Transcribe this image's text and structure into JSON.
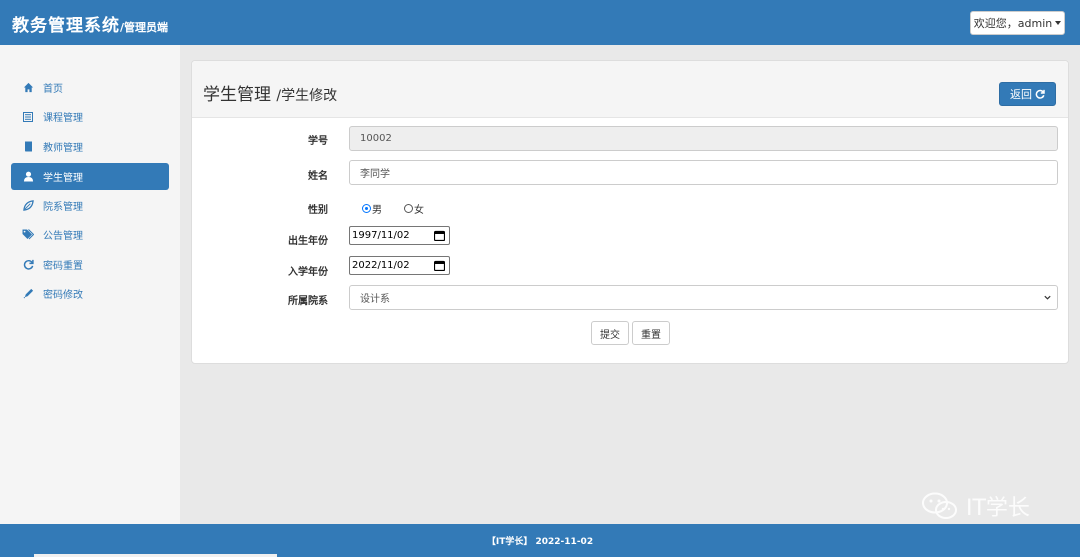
{
  "header": {
    "brand_main": "教务管理系统",
    "brand_sub": "/管理员端",
    "user_menu_label": "欢迎您，admin"
  },
  "sidebar": {
    "items": [
      {
        "label": "首页",
        "icon": "home-icon"
      },
      {
        "label": "课程管理",
        "icon": "list-icon"
      },
      {
        "label": "教师管理",
        "icon": "book-icon"
      },
      {
        "label": "学生管理",
        "icon": "user-icon",
        "active": true
      },
      {
        "label": "院系管理",
        "icon": "leaf-icon"
      },
      {
        "label": "公告管理",
        "icon": "tags-icon"
      },
      {
        "label": "密码重置",
        "icon": "refresh-icon"
      },
      {
        "label": "密码修改",
        "icon": "pencil-icon"
      }
    ]
  },
  "panel": {
    "title": "学生管理",
    "subtitle": "/学生修改",
    "back_label": "返回"
  },
  "form": {
    "student_id_label": "学号",
    "student_id_value": "10002",
    "name_label": "姓名",
    "name_value": "李同学",
    "gender_label": "性别",
    "gender_male": "男",
    "gender_female": "女",
    "gender_selected": "男",
    "birth_label": "出生年份",
    "birth_value": "1997/11/02",
    "enroll_label": "入学年份",
    "enroll_value": "2022/11/02",
    "dept_label": "所属院系",
    "dept_value": "设计系",
    "submit_label": "提交",
    "reset_label": "重置"
  },
  "footer": {
    "text": "【IT学长】 2022-11-02"
  },
  "watermark": {
    "text": "IT学长",
    "icon": "wechat-icon"
  },
  "colors": {
    "primary": "#337ab7",
    "sidebar_bg": "#f5f5f5",
    "page_bg": "#e9e9e9"
  }
}
